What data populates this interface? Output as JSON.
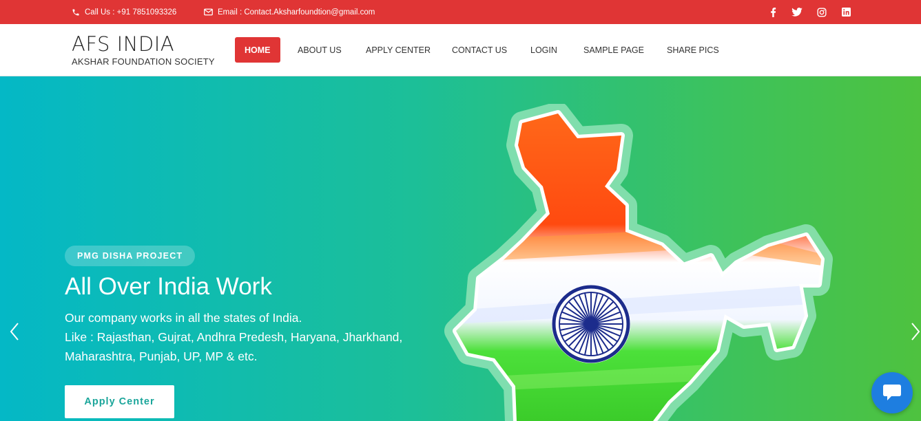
{
  "topbar": {
    "phone_label": "Call Us : +91 7851093326",
    "email_label": "Email :  Contact.Aksharfoundtion@gmail.com",
    "social": [
      "facebook-icon",
      "twitter-icon",
      "instagram-icon",
      "linkedin-icon"
    ]
  },
  "brand": {
    "title": "AFS INDIA",
    "subtitle": "AKSHAR FOUNDATION SOCIETY"
  },
  "nav": {
    "items": [
      {
        "label": "HOME",
        "active": true
      },
      {
        "label": "ABOUT US",
        "active": false
      },
      {
        "label": "APPLY CENTER",
        "active": false
      },
      {
        "label": "CONTACT US",
        "active": false
      },
      {
        "label": "LOGIN",
        "active": false
      },
      {
        "label": "SAMPLE PAGE",
        "active": false
      },
      {
        "label": "SHARE PICS",
        "active": false
      }
    ]
  },
  "hero": {
    "badge": "PMG DISHA PROJECT",
    "title": "All Over India Work",
    "desc_line1": "Our company works in all the states of India.",
    "desc_line2": "Like : Rajasthan, Gujrat, Andhra Predesh, Haryana, Jharkhand,",
    "desc_line3": "Maharashtra, Punjab, UP, MP & etc.",
    "cta": "Apply Center"
  },
  "colors": {
    "accent": "#e03535",
    "hero_start": "#04b8c6",
    "hero_end": "#4ec23f",
    "chat": "#1e7ee0"
  }
}
